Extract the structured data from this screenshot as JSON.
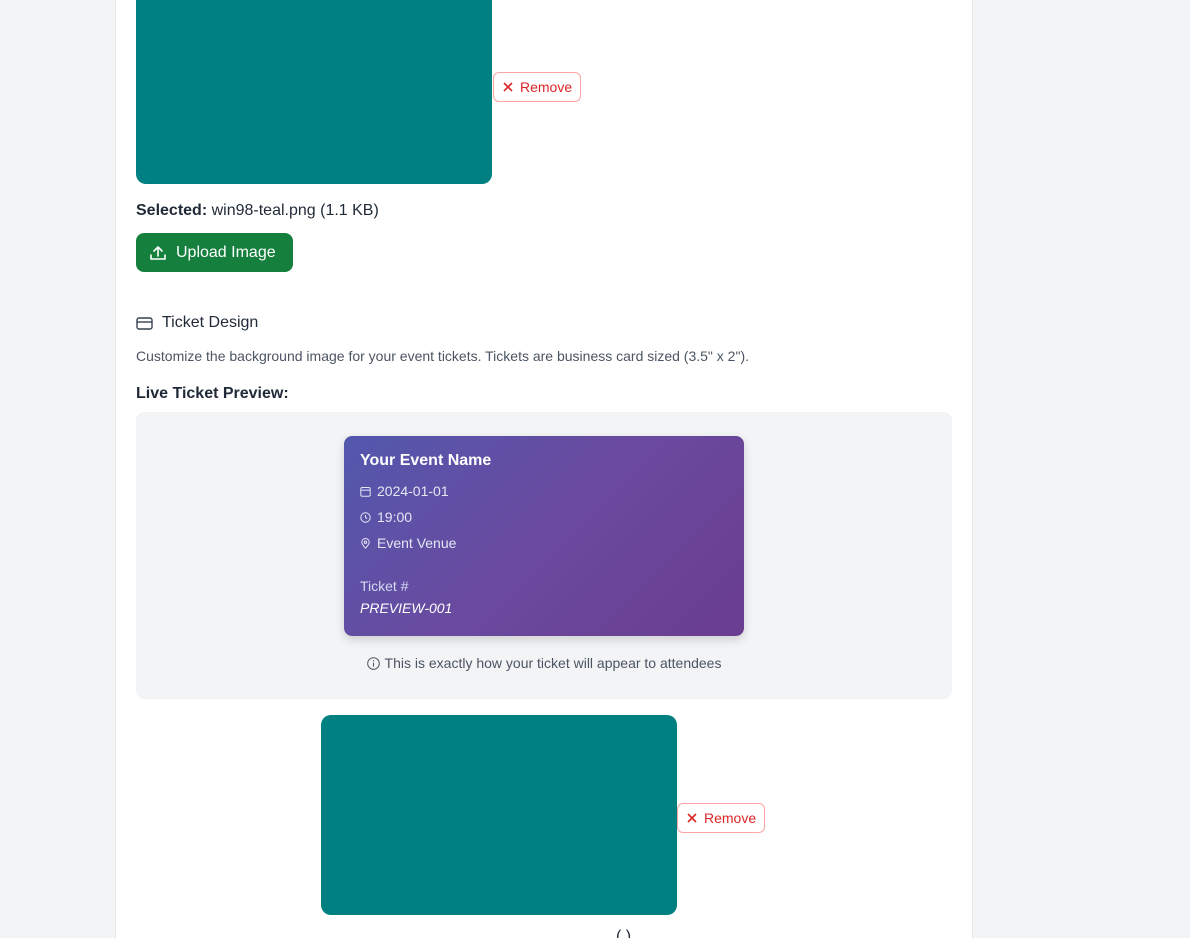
{
  "top_image": {
    "color": "#008080",
    "remove_label": "Remove"
  },
  "selected": {
    "label": "Selected:",
    "value": "win98-teal.png (1.1 KB)"
  },
  "upload": {
    "label": "Upload Image"
  },
  "ticket_design": {
    "title": "Ticket Design",
    "description": "Customize the background image for your event tickets. Tickets are business card sized (3.5\" x 2\").",
    "preview_label": "Live Ticket Preview:"
  },
  "ticket": {
    "event_name": "Your Event Name",
    "date": "2024-01-01",
    "time": "19:00",
    "venue": "Event Venue",
    "number_label": "Ticket #",
    "number": "PREVIEW-001"
  },
  "hint": "This is exactly how your ticket will appear to attendees",
  "bottom_image": {
    "color": "#008080",
    "remove_label": "Remove"
  },
  "bottom_partial_text": "( )"
}
